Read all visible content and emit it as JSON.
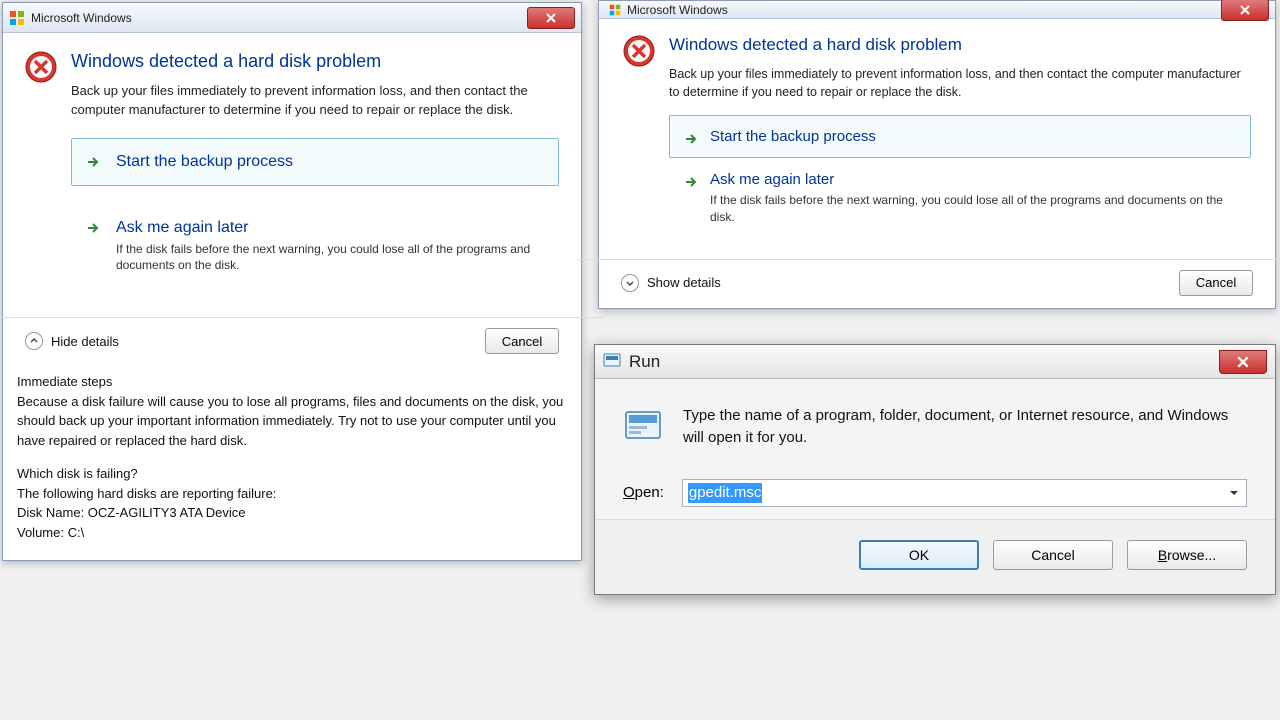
{
  "dialog1": {
    "title": "Microsoft Windows",
    "heading": "Windows detected a hard disk problem",
    "subtext": "Back up your files immediately to prevent information loss, and then contact the computer manufacturer to determine if you need to repair or replace the disk.",
    "opt_backup": "Start the backup process",
    "opt_later_title": "Ask me again later",
    "opt_later_desc": "If the disk fails before the next warning, you could lose all of the programs and documents on the disk.",
    "hide_details": "Hide details",
    "cancel": "Cancel",
    "details_h1": "Immediate steps",
    "details_p1": "Because a disk failure will cause you to lose all programs, files and documents on the disk, you should back up your important information immediately.  Try not to use your computer until you have repaired or replaced the hard disk.",
    "details_h2": "Which disk is failing?",
    "details_p2a": "The following hard disks are reporting failure:",
    "details_p2b": "Disk Name: OCZ-AGILITY3 ATA Device",
    "details_p2c": "Volume: C:\\"
  },
  "dialog2": {
    "title": "Microsoft Windows",
    "heading": "Windows detected a hard disk problem",
    "subtext": "Back up your files immediately to prevent information loss, and then contact the computer manufacturer to determine if you need to repair or replace the disk.",
    "opt_backup": "Start the backup process",
    "opt_later_title": "Ask me again later",
    "opt_later_desc": "If the disk fails before the next warning, you could lose all of the programs and documents on the disk.",
    "show_details": "Show details",
    "cancel": "Cancel"
  },
  "run": {
    "title": "Run",
    "msg": "Type the name of a program, folder, document, or Internet resource, and Windows will open it for you.",
    "open_label": "Open:",
    "open_value": "gpedit.msc",
    "ok": "OK",
    "cancel": "Cancel",
    "browse": "Browse..."
  }
}
